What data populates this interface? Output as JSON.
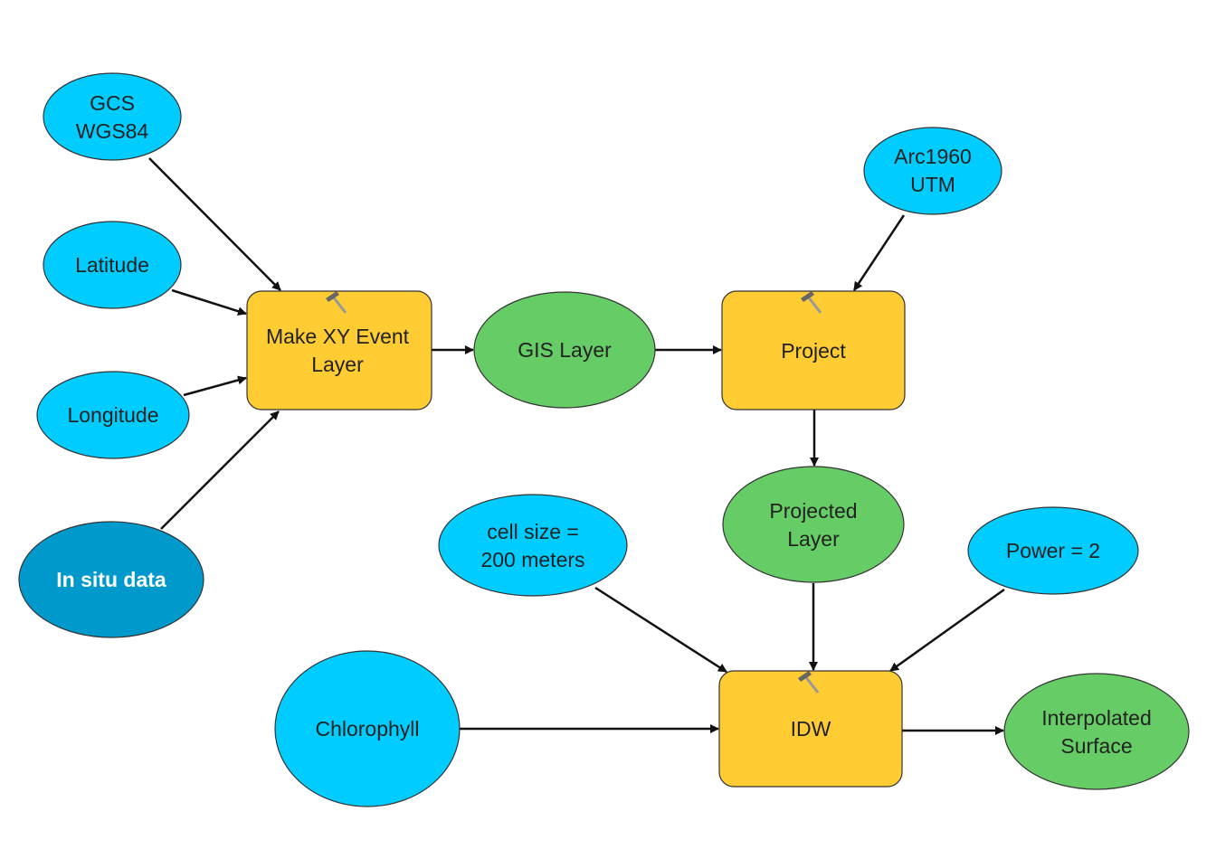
{
  "colors": {
    "input": "#00CCFF",
    "dataset_input": "#0099CC",
    "derived": "#66CC66",
    "tool": "#FFCC33"
  },
  "nodes": {
    "gcs": {
      "line1": "GCS",
      "line2": "WGS84"
    },
    "latitude": {
      "line1": "Latitude"
    },
    "longitude": {
      "line1": "Longitude"
    },
    "in_situ": {
      "line1": "In situ data"
    },
    "make_xy": {
      "line1": "Make XY Event",
      "line2": "Layer",
      "icon": "hammer-icon"
    },
    "gis_layer": {
      "line1": "GIS Layer"
    },
    "arc1960": {
      "line1": "Arc1960",
      "line2": "UTM"
    },
    "project": {
      "line1": "Project",
      "icon": "hammer-icon"
    },
    "projected_layer": {
      "line1": "Projected",
      "line2": "Layer"
    },
    "cell_size": {
      "line1": "cell size =",
      "line2": "200 meters"
    },
    "power": {
      "line1": "Power = 2"
    },
    "chlorophyll": {
      "line1": "Chlorophyll"
    },
    "idw": {
      "line1": "IDW",
      "icon": "hammer-icon"
    },
    "interpolated": {
      "line1": "Interpolated",
      "line2": "Surface"
    }
  }
}
